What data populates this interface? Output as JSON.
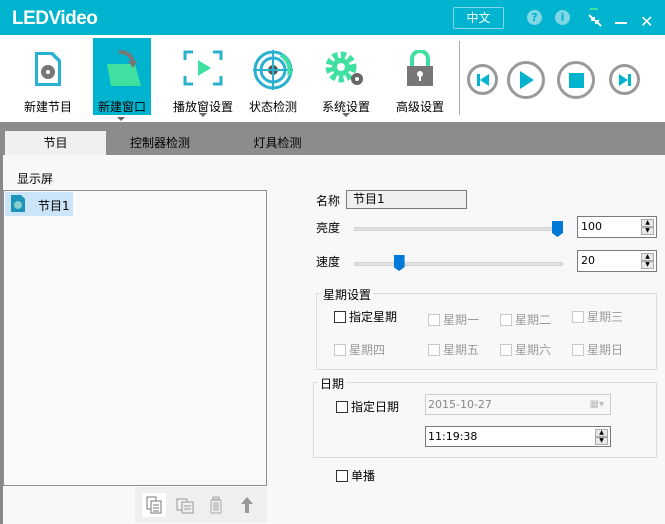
{
  "app": {
    "title": "LEDVideo",
    "language": "中文"
  },
  "toolbar": {
    "items": [
      {
        "label": "新建节目",
        "has_menu": false
      },
      {
        "label": "新建窗口",
        "has_menu": true
      },
      {
        "label": "播放窗设置",
        "has_menu": true
      },
      {
        "label": "状态检测",
        "has_menu": false
      },
      {
        "label": "系统设置",
        "has_menu": true
      },
      {
        "label": "高级设置",
        "has_menu": false
      }
    ]
  },
  "tabs": [
    "节目",
    "控制器检测",
    "灯具检测"
  ],
  "left": {
    "title": "显示屏",
    "items": [
      {
        "label": "节目1"
      }
    ]
  },
  "form": {
    "name_label": "名称",
    "name_value": "节目1",
    "brightness_label": "亮度",
    "brightness_value": "100",
    "brightness_max": 100,
    "speed_label": "速度",
    "speed_value": "20",
    "speed_max": 100,
    "week": {
      "title": "星期设置",
      "specify": "指定星期",
      "days": [
        "星期一",
        "星期二",
        "星期三",
        "星期四",
        "星期五",
        "星期六",
        "星期日"
      ]
    },
    "date": {
      "title": "日期",
      "specify": "指定日期",
      "date_value": "2015-10-27",
      "time_value": "11:19:38"
    },
    "single_play": "单播"
  },
  "colors": {
    "accent": "#00b4cf",
    "slider": "#0078d7"
  }
}
